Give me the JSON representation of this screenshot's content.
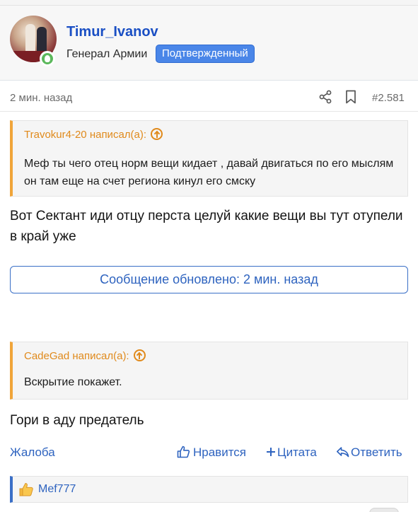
{
  "author": {
    "username": "Timur_Ivanov",
    "rank": "Генерал Армии",
    "badge": "Подтвержденный"
  },
  "post": {
    "time": "2 мин. назад",
    "number": "#2.581",
    "quotes": [
      {
        "header": "Travokur4-20 написал(а):",
        "text": "Меф ты чего отец норм вещи кидает , давай двигаться по его мыслям он там еще на счет региона кинул его смску"
      },
      {
        "header": "CadeGad написал(а):",
        "text": "Вскрытие покажет."
      }
    ],
    "reply_1": "Вот Сектант иди отцу перста целуй какие вещи вы тут отупели в край уже",
    "updated_label": "Сообщение обновлено: 2 мин. назад",
    "reply_2": "Гори в аду предатель"
  },
  "actions": {
    "report": "Жалоба",
    "like": "Нравится",
    "quote": "Цитата",
    "reply": "Ответить"
  },
  "likes": {
    "users": "Mef777"
  },
  "colors": {
    "link": "#2e63bf",
    "username": "#1a4fc4",
    "quote_accent": "#f0a53a",
    "badge": "#4a86e8",
    "online": "#5cb85c"
  },
  "icons": [
    "share-icon",
    "bookmark-icon",
    "arrow-up-circle-icon",
    "thumbs-up-icon",
    "plus-icon",
    "reply-arrow-icon",
    "user-online-icon"
  ]
}
